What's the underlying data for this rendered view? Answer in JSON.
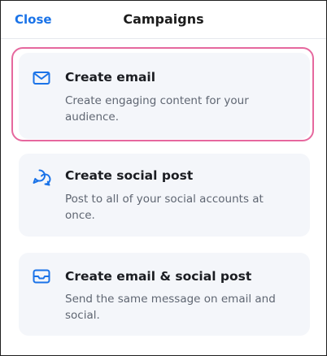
{
  "header": {
    "close_label": "Close",
    "title": "Campaigns"
  },
  "options": [
    {
      "title": "Create email",
      "description": "Create engaging content for your audience.",
      "icon": "envelope-icon",
      "selected": true
    },
    {
      "title": "Create social post",
      "description": "Post to all of your social accounts at once.",
      "icon": "speech-bubbles-icon",
      "selected": false
    },
    {
      "title": "Create email & social post",
      "description": "Send the same message on email and social.",
      "icon": "inbox-icon",
      "selected": false
    }
  ],
  "colors": {
    "accent": "#1a73e8",
    "selection_ring": "#e6689e",
    "card_background": "#f4f6fa"
  }
}
